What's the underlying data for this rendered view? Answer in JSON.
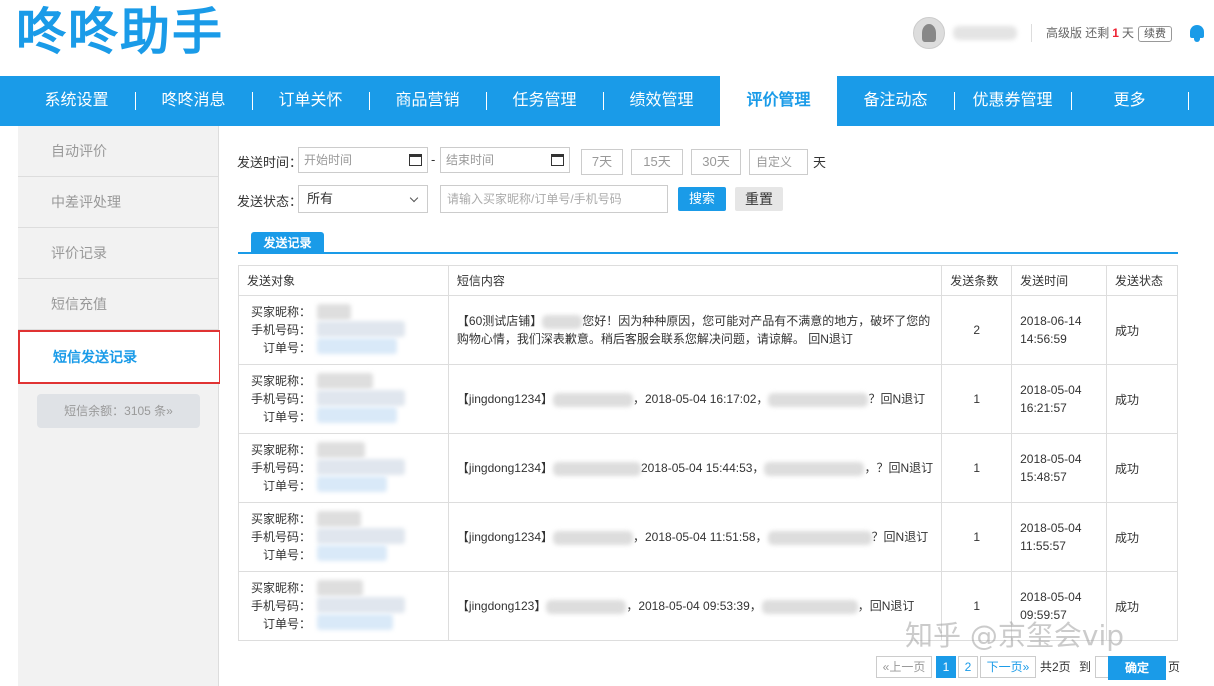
{
  "header": {
    "logo": "咚咚助手",
    "plan_prefix": "高级版 还剩",
    "days_left": "1",
    "days_unit": "天",
    "renew_label": "续费"
  },
  "nav": {
    "items": [
      "系统设置",
      "咚咚消息",
      "订单关怀",
      "商品营销",
      "任务管理",
      "绩效管理",
      "评价管理",
      "备注动态",
      "优惠券管理",
      "更多"
    ],
    "active": "评价管理"
  },
  "sidebar": {
    "items": [
      "自动评价",
      "中差评处理",
      "评价记录",
      "短信充值",
      "短信发送记录"
    ],
    "active": "短信发送记录",
    "balance": "短信余额：3105 条»"
  },
  "filters": {
    "send_time_label": "发送时间：",
    "start_placeholder": "开始时间",
    "end_placeholder": "结束时间",
    "dash": "-",
    "quick": [
      "7天",
      "15天",
      "30天"
    ],
    "custom_placeholder": "自定义",
    "custom_unit": "天",
    "status_label": "发送状态：",
    "status_value": "所有",
    "search_placeholder": "请输入买家昵称/订单号/手机号码",
    "search_button": "搜索",
    "reset_button": "重置"
  },
  "tab": {
    "label": "发送记录"
  },
  "table": {
    "headers": [
      "发送对象",
      "短信内容",
      "发送条数",
      "发送时间",
      "发送状态"
    ],
    "target_labels": [
      "买家昵称：",
      "手机号码：",
      "订单号："
    ],
    "rows": [
      {
        "content_a": "【60测试店铺】",
        "content_b": "您好！因为种种原因，您可能对产品有不满意的地方，破坏了您的购物心情，我们深表歉意。稍后客服会联系您解决问题，请谅解。 回N退订",
        "count": "2",
        "time_date": "2018-06-14",
        "time_clock": "14:56:59",
        "status": "成功"
      },
      {
        "content_a": "【jingdong1234】",
        "content_b": "，2018-05-04 16:17:02，",
        "content_c": "？回N退订",
        "count": "1",
        "time_date": "2018-05-04",
        "time_clock": "16:21:57",
        "status": "成功"
      },
      {
        "content_a": "【jingdong1234】",
        "content_b": "2018-05-04 15:44:53，",
        "content_c": "，？回N退订",
        "count": "1",
        "time_date": "2018-05-04",
        "time_clock": "15:48:57",
        "status": "成功"
      },
      {
        "content_a": "【jingdong1234】",
        "content_b": "，2018-05-04 11:51:58，",
        "content_c": "？回N退订",
        "count": "1",
        "time_date": "2018-05-04",
        "time_clock": "11:55:57",
        "status": "成功"
      },
      {
        "content_a": "【jingdong123】",
        "content_b": "，2018-05-04 09:53:39，",
        "content_c": "，回N退订",
        "count": "1",
        "time_date": "2018-05-04",
        "time_clock": "09:59:57",
        "status": "成功"
      }
    ]
  },
  "pagination": {
    "prev": "«上一页",
    "pages": [
      "1",
      "2"
    ],
    "current": "1",
    "next": "下一页»",
    "total": "共2页",
    "goto": "到",
    "page_unit": "页",
    "confirm": "确定"
  },
  "watermark": "知乎 @京玺会vip"
}
